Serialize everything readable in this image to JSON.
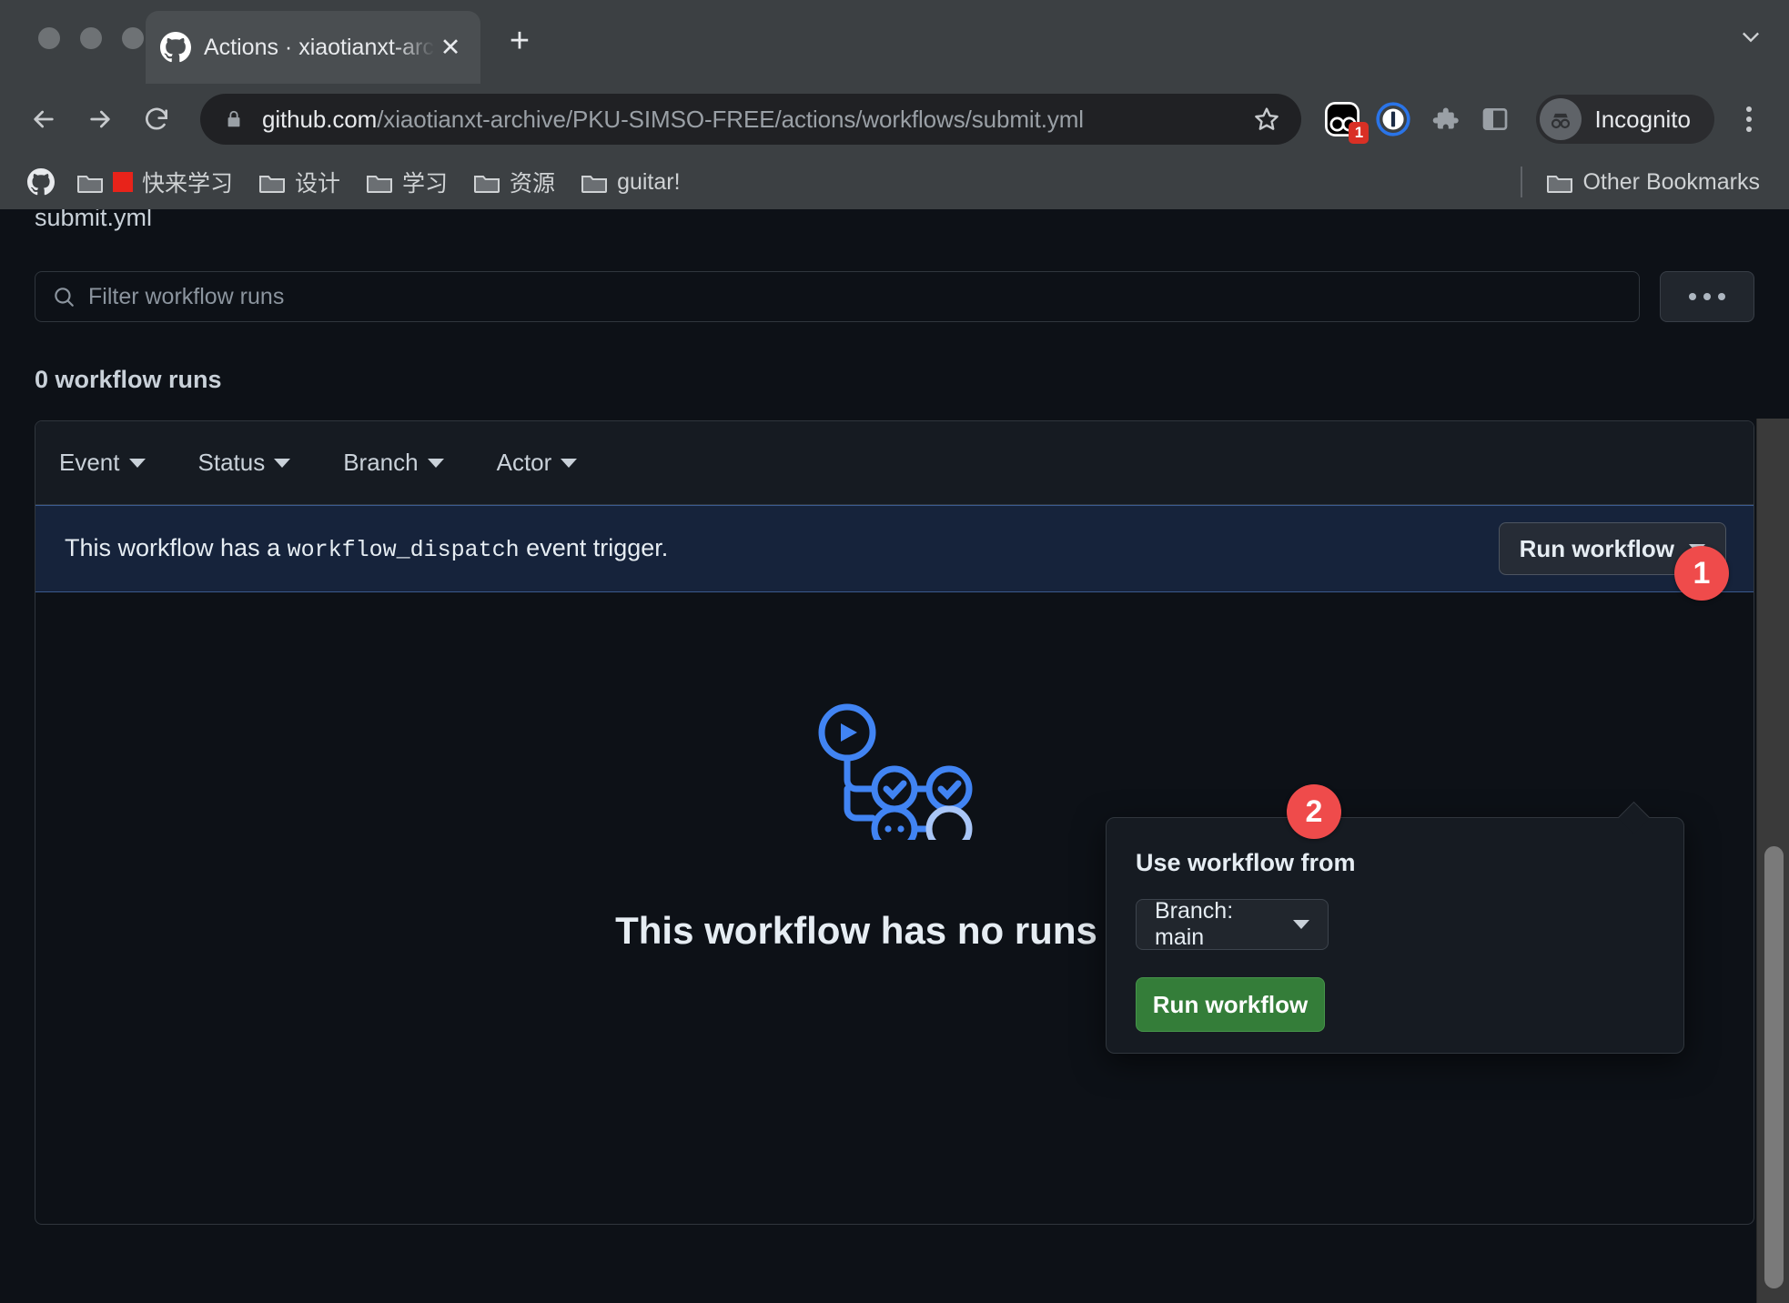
{
  "browser": {
    "tab": {
      "title": "Actions · xiaotianxt-archive/PKU",
      "favicon": "github-icon",
      "close_label": "✕"
    },
    "new_tab_label": "+",
    "nav": {
      "back": "←",
      "forward": "→",
      "reload": "⟳"
    },
    "omnibox": {
      "lock": "lock-icon",
      "domain": "github.com",
      "path": "/xiaotianxt-archive/PKU-SIMSO-FREE/actions/workflows/submit.yml",
      "bookmark_star": "star-icon"
    },
    "extensions": [
      {
        "name": "extension-badge-icon",
        "badge": "1"
      },
      {
        "name": "onepassword-icon",
        "badge": ""
      },
      {
        "name": "puzzle-extensions-icon",
        "badge": ""
      },
      {
        "name": "side-panel-icon",
        "badge": ""
      }
    ],
    "profile": {
      "label": "Incognito",
      "icon": "incognito-icon"
    },
    "menu_icon": "kebab-menu-icon",
    "bookmarks": [
      {
        "label": "快来学习",
        "icon": "folder-icon",
        "swatch": "#e8231a"
      },
      {
        "label": "设计",
        "icon": "folder-icon"
      },
      {
        "label": "学习",
        "icon": "folder-icon"
      },
      {
        "label": "资源",
        "icon": "folder-icon"
      },
      {
        "label": "guitar!",
        "icon": "folder-icon"
      }
    ],
    "other_bookmarks": "Other Bookmarks"
  },
  "page": {
    "breadcrumb_file": "submit.yml",
    "search": {
      "placeholder": "Filter workflow runs",
      "icon": "search-icon"
    },
    "more_button": "…",
    "runs_count": "0 workflow runs",
    "filters": [
      {
        "label": "Event"
      },
      {
        "label": "Status"
      },
      {
        "label": "Branch"
      },
      {
        "label": "Actor"
      }
    ],
    "dispatch_banner": {
      "text_before": "This workflow has a",
      "code": "workflow_dispatch",
      "text_after": "event trigger.",
      "run_button": "Run workflow"
    },
    "popover": {
      "title": "Use workflow from",
      "branch_select": "Branch: main",
      "run_button": "Run workflow"
    },
    "empty_state": {
      "title": "This workflow has no runs yet.",
      "illustration": "workflow-graph-icon"
    },
    "markers": [
      {
        "label": "1"
      },
      {
        "label": "2"
      }
    ],
    "colors": {
      "accent_green": "#347d39",
      "marker_red": "#ef4b4b",
      "banner_blue": "#16233b",
      "illustration_blue": "#4184f3"
    }
  }
}
